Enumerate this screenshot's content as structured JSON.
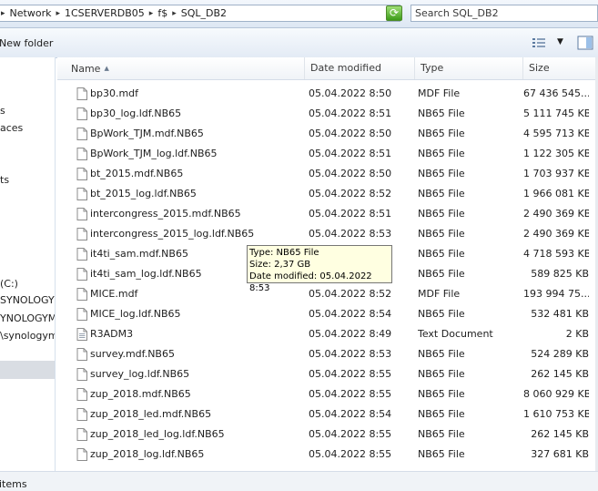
{
  "address": {
    "breadcrumbs": [
      "Network",
      "1CSERVERDB05",
      "f$",
      "SQL_DB2"
    ],
    "search_placeholder": "Search SQL_DB2"
  },
  "toolbar": {
    "new_folder_label": "New folder"
  },
  "nav": {
    "items": [
      "s",
      "aces",
      "ts",
      "(C:)",
      "SYNOLOGYM",
      "YNOLOGYMC",
      "\\synologymo"
    ]
  },
  "columns": {
    "name": "Name",
    "date": "Date modified",
    "type": "Type",
    "size": "Size"
  },
  "files": [
    {
      "name": "bp30.mdf",
      "date": "05.04.2022 8:50",
      "type": "MDF File",
      "size": "67 436 545..."
    },
    {
      "name": "bp30_log.ldf.NB65",
      "date": "05.04.2022 8:51",
      "type": "NB65 File",
      "size": "5 111 745 KB"
    },
    {
      "name": "BpWork_TJM.mdf.NB65",
      "date": "05.04.2022 8:50",
      "type": "NB65 File",
      "size": "4 595 713 KB"
    },
    {
      "name": "BpWork_TJM_log.ldf.NB65",
      "date": "05.04.2022 8:51",
      "type": "NB65 File",
      "size": "1 122 305 KB"
    },
    {
      "name": "bt_2015.mdf.NB65",
      "date": "05.04.2022 8:50",
      "type": "NB65 File",
      "size": "1 703 937 KB"
    },
    {
      "name": "bt_2015_log.ldf.NB65",
      "date": "05.04.2022 8:52",
      "type": "NB65 File",
      "size": "1 966 081 KB"
    },
    {
      "name": "intercongress_2015.mdf.NB65",
      "date": "05.04.2022 8:51",
      "type": "NB65 File",
      "size": "2 490 369 KB"
    },
    {
      "name": "intercongress_2015_log.ldf.NB65",
      "date": "05.04.2022 8:53",
      "type": "NB65 File",
      "size": "2 490 369 KB"
    },
    {
      "name": "it4ti_sam.mdf.NB65",
      "date": "05.04.2022 8:53",
      "type": "NB65 File",
      "size": "4 718 593 KB"
    },
    {
      "name": "it4ti_sam_log.ldf.NB65",
      "date": "05.04.2022 8:53",
      "type": "NB65 File",
      "size": "589 825 KB"
    },
    {
      "name": "MICE.mdf",
      "date": "05.04.2022 8:52",
      "type": "MDF File",
      "size": "193 994 75..."
    },
    {
      "name": "MICE_log.ldf.NB65",
      "date": "05.04.2022 8:54",
      "type": "NB65 File",
      "size": "532 481 KB"
    },
    {
      "name": "R3ADM3",
      "date": "05.04.2022 8:49",
      "type": "Text Document",
      "size": "2 KB"
    },
    {
      "name": "survey.mdf.NB65",
      "date": "05.04.2022 8:53",
      "type": "NB65 File",
      "size": "524 289 KB"
    },
    {
      "name": "survey_log.ldf.NB65",
      "date": "05.04.2022 8:55",
      "type": "NB65 File",
      "size": "262 145 KB"
    },
    {
      "name": "zup_2018.mdf.NB65",
      "date": "05.04.2022 8:55",
      "type": "NB65 File",
      "size": "8 060 929 KB"
    },
    {
      "name": "zup_2018_led.mdf.NB65",
      "date": "05.04.2022 8:54",
      "type": "NB65 File",
      "size": "1 610 753 KB"
    },
    {
      "name": "zup_2018_led_log.ldf.NB65",
      "date": "05.04.2022 8:55",
      "type": "NB65 File",
      "size": "262 145 KB"
    },
    {
      "name": "zup_2018_log.ldf.NB65",
      "date": "05.04.2022 8:55",
      "type": "NB65 File",
      "size": "327 681 KB"
    }
  ],
  "tooltip": {
    "type_line": "Type: NB65 File",
    "size_line": "Size: 2,37 GB",
    "date_line": "Date modified: 05.04.2022 8:53"
  },
  "status": {
    "items_text": "items"
  },
  "colors": {
    "tooltip_bg": "#ffffe1",
    "refresh_green": "#3c9b18"
  },
  "icons": {
    "refresh": "refresh-icon",
    "file": "document-icon",
    "views": "details-view-icon",
    "preview_pane": "preview-pane-icon"
  }
}
